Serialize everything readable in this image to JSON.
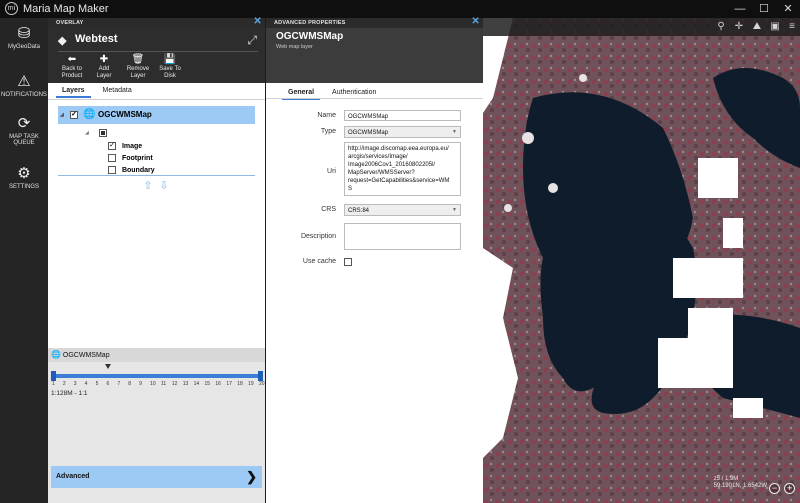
{
  "app": {
    "title": "Maria Map Maker",
    "logo": "mi"
  },
  "window": {
    "minimize": "—",
    "maximize": "☐",
    "close": "✕"
  },
  "nav": {
    "items": [
      {
        "label": "MyGeoData",
        "icon": "cubes-icon",
        "glyph": "⛁"
      },
      {
        "label": "NOTIFICATIONS",
        "icon": "alert-icon",
        "glyph": "⚠"
      },
      {
        "label_line1": "MAP TASK",
        "label_line2": "QUEUE",
        "icon": "refresh-icon",
        "glyph": "⟳"
      },
      {
        "label": "SETTINGS",
        "icon": "gear-icon",
        "glyph": "⚙"
      }
    ]
  },
  "overlay": {
    "header": "OVERLAY",
    "close": "✕",
    "title": "Webtest",
    "expand": "⤢",
    "toolbar": [
      {
        "line1": "Back to",
        "line2": "Product",
        "glyph": "⬅"
      },
      {
        "line1": "Add",
        "line2": "Layer",
        "glyph": "✚"
      },
      {
        "line1": "Remove",
        "line2": "Layer",
        "glyph": "🗑"
      },
      {
        "line1": "Save To",
        "line2": "Disk",
        "glyph": "💾"
      }
    ],
    "tabs": [
      "Layers",
      "Metadata"
    ],
    "layer": {
      "name": "OGCWMSMap",
      "checked": "✓",
      "sublayers": [
        {
          "label": "Image",
          "checked": "✓",
          "bold": true
        },
        {
          "label": "Footprint",
          "checked": "",
          "bold": true
        },
        {
          "label": "Boundary",
          "checked": "",
          "bold": true
        }
      ]
    },
    "move_up": "⇧",
    "move_down": "⇩",
    "scale": {
      "layer_name": "OGCWMSMap",
      "ticks": [
        "1",
        "2",
        "3",
        "4",
        "5",
        "6",
        "7",
        "8",
        "9",
        "10",
        "11",
        "12",
        "13",
        "14",
        "15",
        "16",
        "17",
        "18",
        "19",
        "20"
      ],
      "selected_level": 6,
      "range_text": "1:128M - 1:1"
    },
    "advanced_label": "Advanced",
    "advanced_chevron": "❯"
  },
  "advanced_properties": {
    "header": "ADVANCED PROPERTIES",
    "close": "✕",
    "name": "OGCWMSMap",
    "subtitle": "Web map layer",
    "tabs": [
      "General",
      "Authentication"
    ],
    "fields": {
      "name_label": "Name",
      "name_value": "OGCWMSMap",
      "type_label": "Type",
      "type_value": "OGCWMSMap",
      "uri_label": "Uri",
      "uri_lines": [
        "http://image.discomap.eea.europa.eu/",
        "arcgis/services/Image/",
        "Image2006Cov1_20160802205l/",
        "MapServer/WMSServer?",
        "request=GetCapabilities&service=WM",
        "S"
      ],
      "crs_label": "CRS",
      "crs_value": "CRS:84",
      "description_label": "Description",
      "description_value": "",
      "use_cache_label": "Use cache"
    }
  },
  "map": {
    "tools": [
      "pin-icon",
      "crosshair-icon",
      "terrain-icon",
      "image-icon",
      "layers-icon"
    ],
    "tool_glyphs": [
      "⚲",
      "✛",
      "⛰",
      "▣",
      "≡"
    ],
    "status_line1": "z5 / 1:9M",
    "status_line2": "59.1901N, 1.6542W",
    "zoom_out": "−",
    "zoom_in": "+"
  }
}
